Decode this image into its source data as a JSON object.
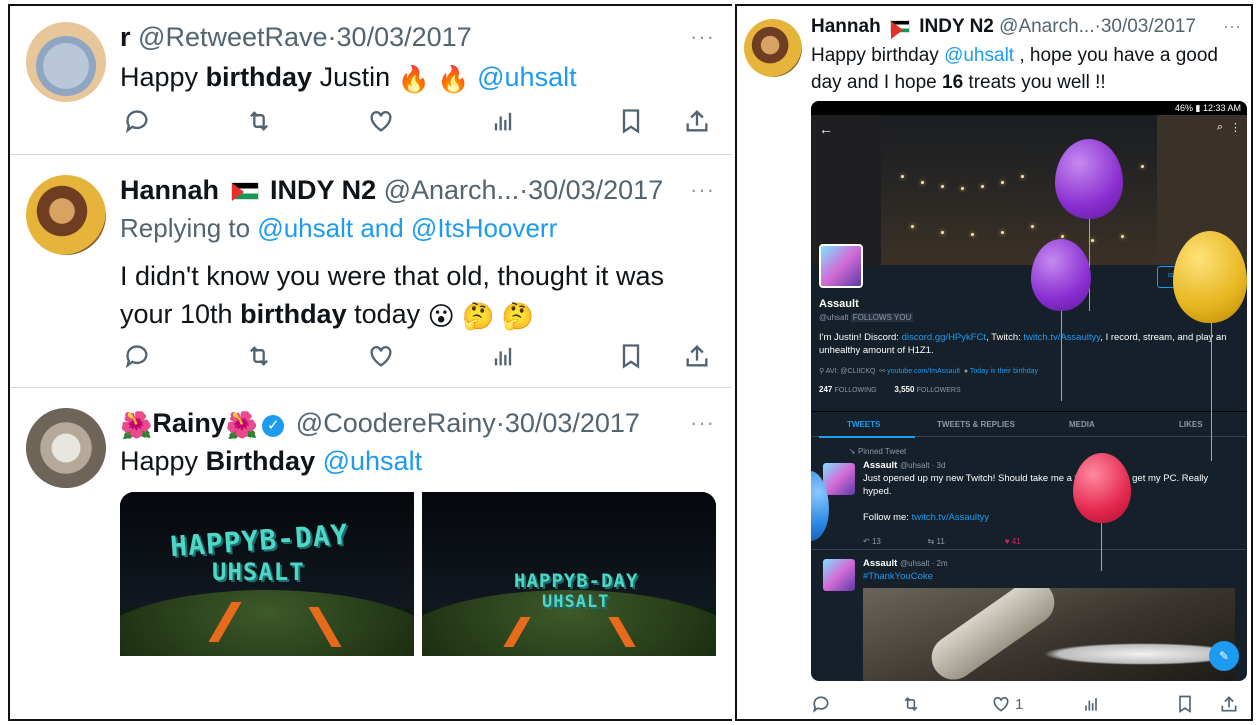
{
  "left_tweets": [
    {
      "name": "r",
      "handle": "@RetweetRave",
      "dot": "·",
      "date": "30/03/2017",
      "more": "···",
      "text_pre": "Happy ",
      "text_bold": "birthday",
      "text_post": " Justin ",
      "emoji": "🔥 🔥",
      "mention": "@uhsalt"
    },
    {
      "name": "Hannah",
      "name_suffix": "INDY N2",
      "handle": "@Anarch...",
      "dot": "·",
      "date": "30/03/2017",
      "more": "···",
      "replying_label": "Replying to ",
      "reply_mention_1": "@uhsalt",
      "reply_and": " and ",
      "reply_mention_2": "@ItsHooverr",
      "line1": "I didn't know you were that old, thought it was",
      "line2_pre": "your 10th ",
      "line2_bold": "birthday",
      "line2_post": " today ",
      "emoji": "😮 🤔 🤔"
    },
    {
      "name_prefix_emoji": "🌺",
      "name": "Rainy",
      "name_suffix_emoji": "🌺",
      "verified": "✓",
      "handle": "@CoodereRainy",
      "dot": "·",
      "date": "30/03/2017",
      "more": "···",
      "text_pre": "Happy ",
      "text_bold": "Birthday",
      "mention": "@uhsalt",
      "image_text_1": "HAPPYB-DAY",
      "image_text_2": "UHSALT"
    }
  ],
  "right_tweet": {
    "name": "Hannah",
    "name_suffix": "INDY N2",
    "handle": "@Anarch...",
    "dot": "·",
    "date": "30/03/2017",
    "more": "···",
    "text_1": "Happy birthday ",
    "mention": "@uhsalt",
    "text_2": " , hope you have a good day and I hope ",
    "bold_num": "16",
    "text_3": " treats you well !!",
    "like_count": "1"
  },
  "phone": {
    "status": "46% ▮ 12:33 AM",
    "profile_name": "Assault",
    "profile_handle": "@uhsalt",
    "follows_you": "FOLLOWS YOU",
    "bio_pre": "I'm Justin! Discord: ",
    "bio_link_1": "discord.gg/HPykFCt",
    "bio_mid": ", Twitch: ",
    "bio_link_2": "twitch.tv/Assaultyy",
    "bio_post": ", I record, stream, and play an unhealthy amount of H1Z1.",
    "meta_avi": "AVI: @CLIICKQ",
    "meta_link": "youtube.com/ImAssault",
    "meta_bday": "Today is their birthday",
    "following_count": "247",
    "following_label": "FOLLOWING",
    "followers_count": "3,550",
    "followers_label": "FOLLOWERS",
    "tabs": [
      "TWEETS",
      "TWEETS & REPLIES",
      "MEDIA",
      "LIKES"
    ],
    "pinned_label": "Pinned Tweet",
    "t1_name": "Assault",
    "t1_meta": "@uhsalt · 3d",
    "t1_text": "Just opened up my new Twitch! Should take me a few weeks to get my PC. Really hyped.",
    "t1_follow": "Follow me: ",
    "t1_follow_link": "twitch.tv/Assaultyy",
    "t1_replies": "13",
    "t1_rts": "11",
    "t1_likes": "41",
    "t2_name": "Assault",
    "t2_meta": "@uhsalt · 2m",
    "t2_tag": "#ThankYouCoke"
  },
  "colors": {
    "link": "#1d9bf0",
    "muted": "#536471",
    "dark_bg": "#15202b"
  },
  "icons": [
    "reply-icon",
    "retweet-icon",
    "like-icon",
    "views-icon",
    "bookmark-icon",
    "share-icon"
  ]
}
